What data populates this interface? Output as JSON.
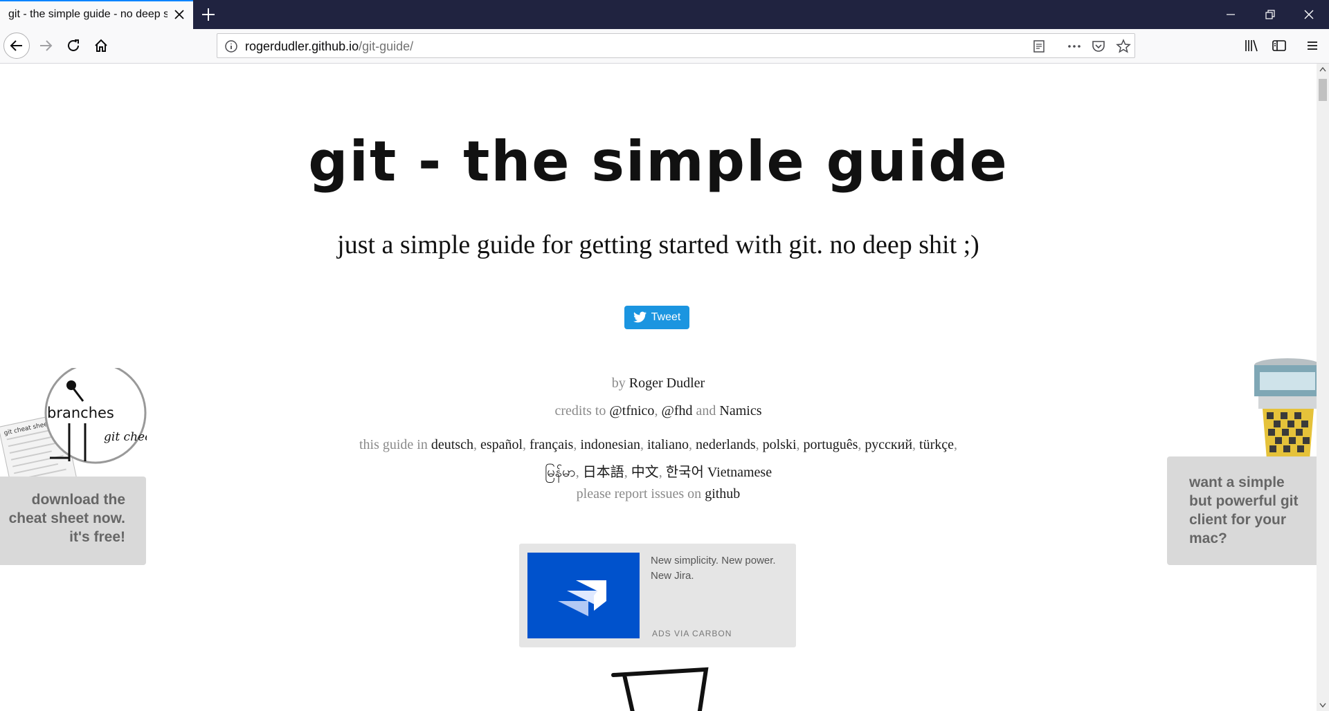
{
  "browser": {
    "tab_title": "git - the simple guide - no deep shit!",
    "url_host": "rogerdudler.github.io",
    "url_path": "/git-guide/"
  },
  "page": {
    "title": "git - the simple guide",
    "subtitle": "just a simple guide for getting started with git. no deep shit ;)",
    "tweet_label": "Tweet",
    "by_prefix": "by",
    "author": "Roger Dudler",
    "credits_prefix": "credits to",
    "credit_1": "@tfnico",
    "credit_2": "@fhd",
    "credits_and": "and",
    "credit_3": "Namics",
    "languages_prefix": "this guide in",
    "languages": [
      "deutsch",
      "español",
      "français",
      "indonesian",
      "italiano",
      "nederlands",
      "polski",
      "português",
      "русский",
      "türkçe",
      "မြန်မာ",
      "日本語",
      "中文",
      "한국어",
      "Vietnamese"
    ],
    "issues_prefix": "please report issues on",
    "issues_link": "github"
  },
  "promos": {
    "cheat_sheet": "download the cheat sheet now. it's free!",
    "cheat_image_text_1": "branches",
    "cheat_image_text_2": "git check",
    "cheat_image_text_3": "git cheat sheet",
    "mac_client": "want a simple but powerful git client for your mac?"
  },
  "ad": {
    "text": "New simplicity. New power. New Jira.",
    "via": "ADS VIA CARBON"
  },
  "colors": {
    "titlebar": "#202340",
    "tweet": "#1b95e0",
    "jira": "#0052cc"
  }
}
